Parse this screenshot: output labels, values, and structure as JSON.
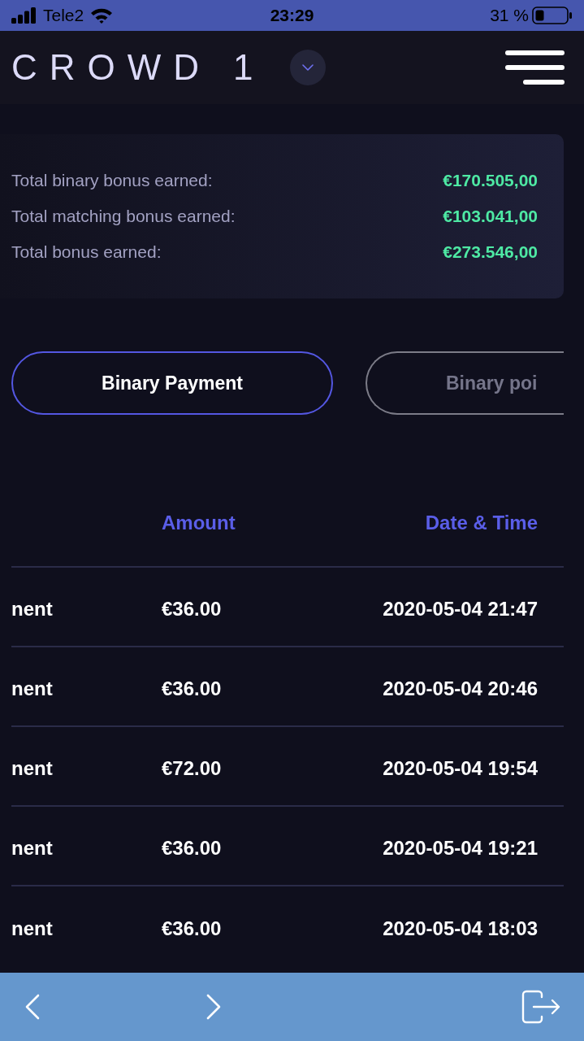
{
  "status_bar": {
    "carrier": "Tele2",
    "time": "23:29",
    "battery": "31 %"
  },
  "header": {
    "logo": "CROWD 1"
  },
  "summary": [
    {
      "label": "Total binary bonus earned:",
      "value": "€170.505,00"
    },
    {
      "label": "Total matching bonus earned:",
      "value": "€103.041,00"
    },
    {
      "label": "Total bonus earned:",
      "value": "€273.546,00"
    }
  ],
  "tabs": [
    {
      "label": "Binary Payment",
      "selected": true
    },
    {
      "label": "Binary poi",
      "selected": false
    }
  ],
  "table": {
    "columns": [
      "Amount",
      "Date & Time"
    ],
    "rows": [
      {
        "column_1": "nent",
        "amount": "€36.00",
        "date_time": "2020-05-04 21:47"
      },
      {
        "column_1": "nent",
        "amount": "€36.00",
        "date_time": "2020-05-04 20:46"
      },
      {
        "column_1": "nent",
        "amount": "€72.00",
        "date_time": "2020-05-04 19:54"
      },
      {
        "column_1": "nent",
        "amount": "€36.00",
        "date_time": "2020-05-04 19:21"
      },
      {
        "column_1": "nent",
        "amount": "€36.00",
        "date_time": "2020-05-04 18:03"
      }
    ]
  }
}
